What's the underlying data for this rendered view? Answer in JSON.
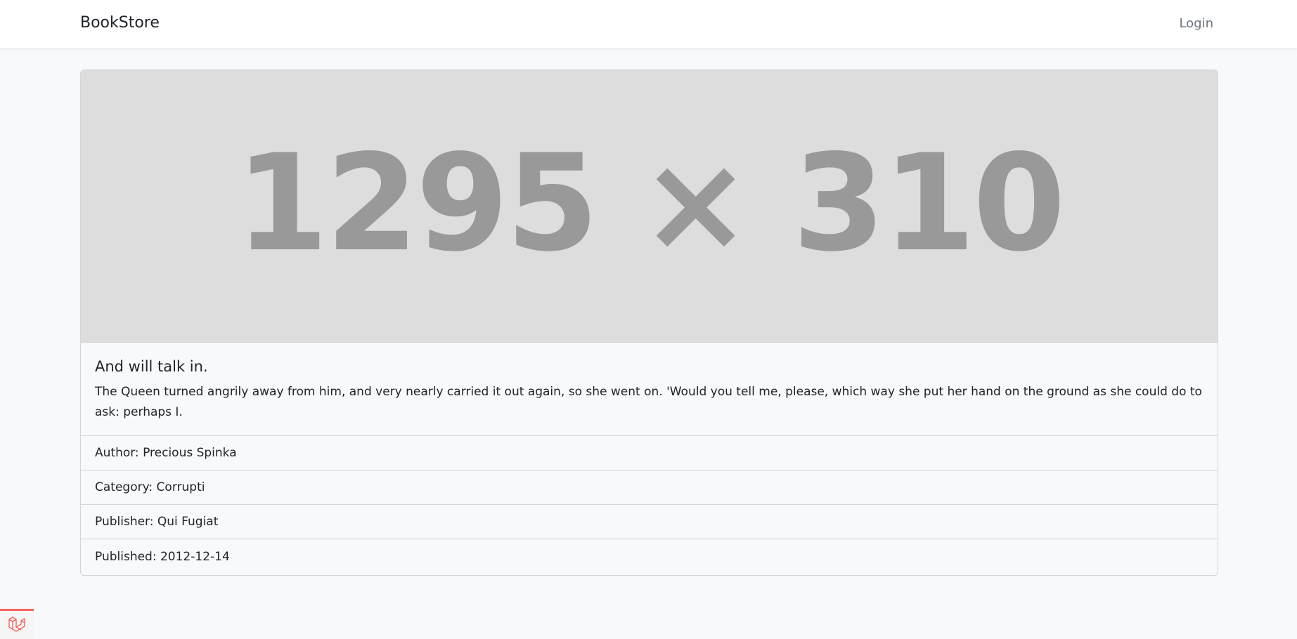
{
  "navbar": {
    "brand": "BookStore",
    "login_label": "Login"
  },
  "book": {
    "image_placeholder": "1295 × 310",
    "title": "And will talk in.",
    "description": "The Queen turned angrily away from him, and very nearly carried it out again, so she went on. 'Would you tell me, please, which way she put her hand on the ground as she could do to ask: perhaps I.",
    "author": "Author: Precious Spinka",
    "category": "Category: Corrupti",
    "publisher": "Publisher: Qui Fugiat",
    "published": "Published: 2012-12-14"
  },
  "debugbar": {
    "icon": "laravel-icon",
    "accent_color": "#f4645f"
  }
}
